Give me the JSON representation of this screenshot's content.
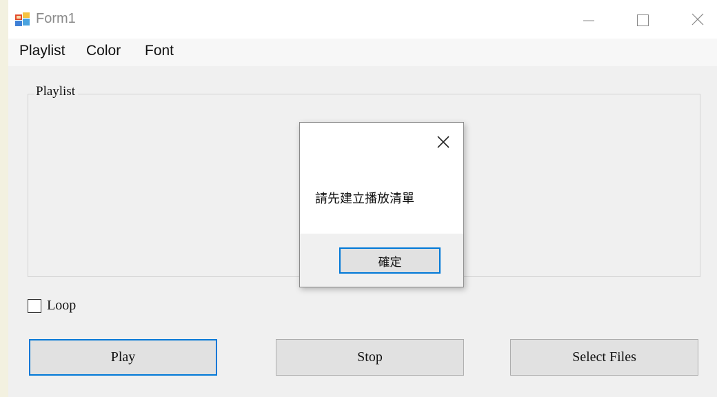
{
  "window": {
    "title": "Form1",
    "controls": {
      "minimize": "minimize-icon",
      "maximize": "maximize-icon",
      "close": "close-icon"
    }
  },
  "menu": {
    "items": [
      "Playlist",
      "Color",
      "Font"
    ]
  },
  "playlist_group": {
    "label": "Playlist"
  },
  "loop": {
    "label": "Loop",
    "checked": false
  },
  "buttons": {
    "play": "Play",
    "stop": "Stop",
    "select_files": "Select Files"
  },
  "dialog": {
    "message": "請先建立播放清單",
    "ok_label": "確定"
  },
  "colors": {
    "focus_border": "#0078d7",
    "button_face": "#e1e1e1",
    "window_bg": "#f0f0f0"
  }
}
